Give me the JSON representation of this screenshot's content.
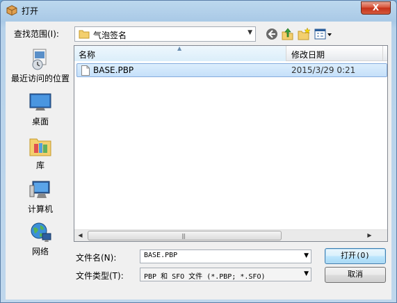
{
  "window": {
    "title": "打开",
    "close_label": "X"
  },
  "lookin": {
    "label": "查找范围(I):",
    "value": "气泡签名"
  },
  "places": [
    {
      "label": "最近访问的位置",
      "icon": "recent-places-icon"
    },
    {
      "label": "桌面",
      "icon": "desktop-icon"
    },
    {
      "label": "库",
      "icon": "libraries-icon"
    },
    {
      "label": "计算机",
      "icon": "computer-icon"
    },
    {
      "label": "网络",
      "icon": "network-icon"
    }
  ],
  "filelist": {
    "columns": [
      "名称",
      "修改日期"
    ],
    "files": [
      {
        "name": "BASE.PBP",
        "date": "2015/3/29 0:21"
      }
    ]
  },
  "filename": {
    "label": "文件名(N):",
    "value": "BASE.PBP"
  },
  "filetype": {
    "label": "文件类型(T):",
    "value": "PBP 和 SFO 文件 (*.PBP; *.SFO)"
  },
  "buttons": {
    "open": "打开(O)",
    "cancel": "取消"
  },
  "colors": {
    "title_bar": "#a9c9e6",
    "selection": "#c5e0fa",
    "close": "#c5311a"
  }
}
